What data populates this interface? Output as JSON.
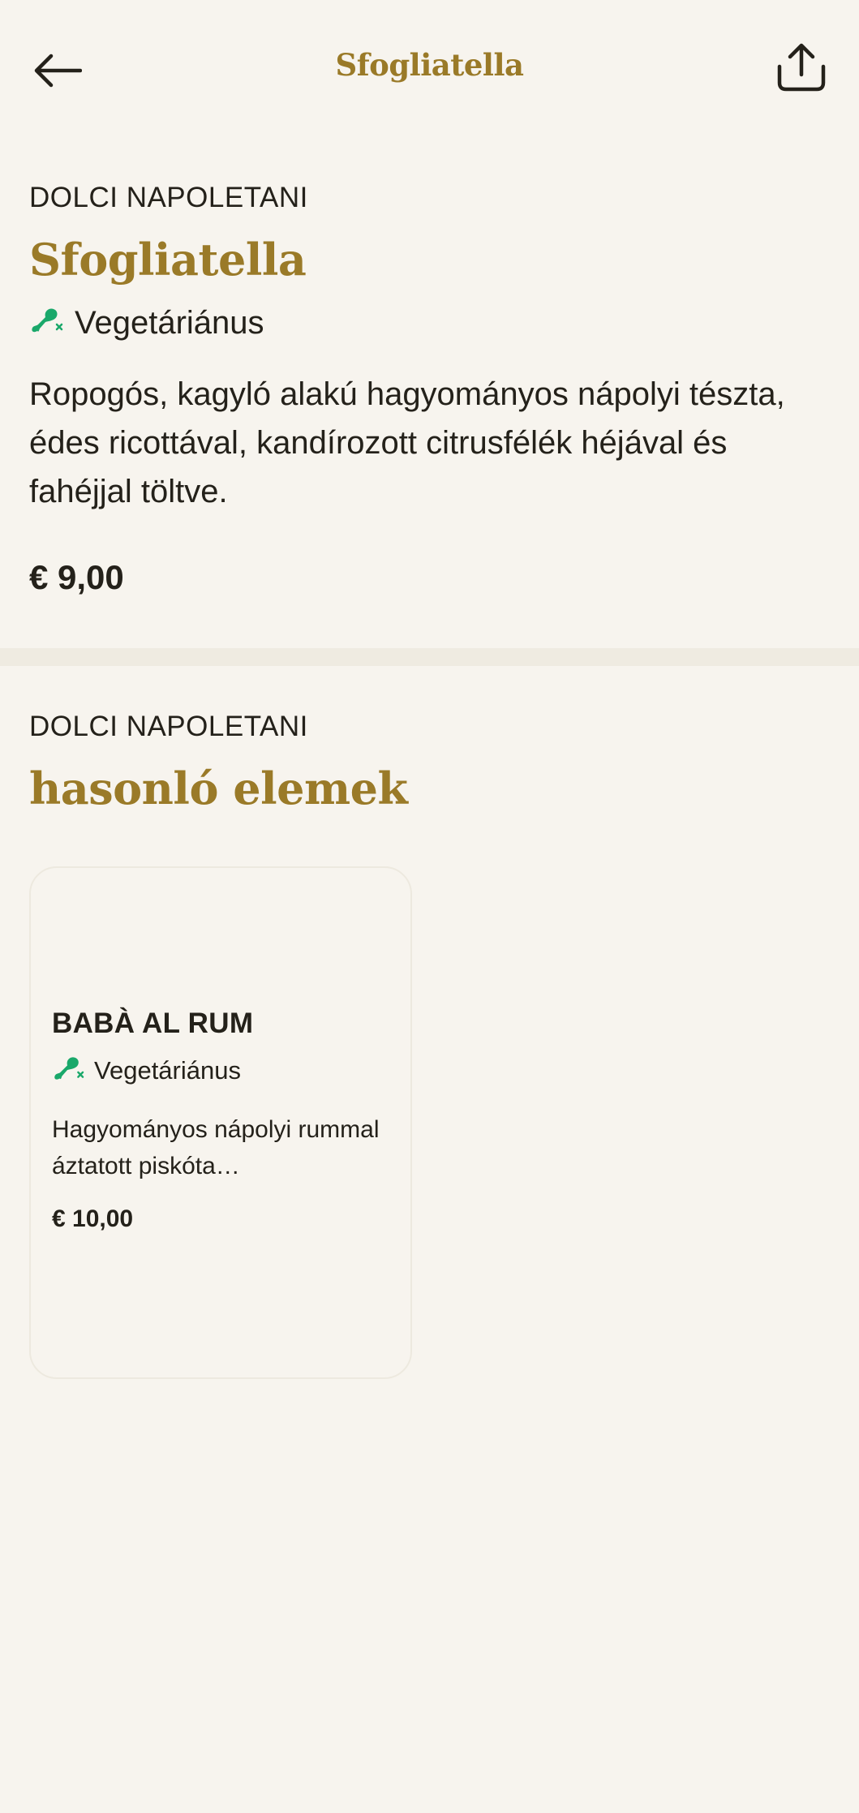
{
  "header": {
    "title": "Sfogliatella",
    "back_icon": "arrow-left-icon",
    "share_icon": "share-icon"
  },
  "item": {
    "category": "DOLCI NAPOLETANI",
    "name": "Sfogliatella",
    "diet": {
      "icon": "vegetarian-drumstick-icon",
      "label": "Vegetáriánus",
      "color": "#1aa86a"
    },
    "description": "Ropogós, kagyló alakú hagyományos nápolyi tészta, édes ricottával, kandírozott citrusfélék héjával és fahéjjal töltve.",
    "price": "€ 9,00"
  },
  "similar": {
    "category": "DOLCI NAPOLETANI",
    "title": "hasonló elemek",
    "items": [
      {
        "name": "BABÀ AL RUM",
        "diet_label": "Vegetáriánus",
        "description": "Hagyományos nápolyi rummal áztatott piskóta…",
        "price": "€ 10,00"
      }
    ]
  },
  "colors": {
    "background": "#f7f4ee",
    "accent": "#9a7a28",
    "text": "#24211a",
    "diet_green": "#1aa86a"
  }
}
